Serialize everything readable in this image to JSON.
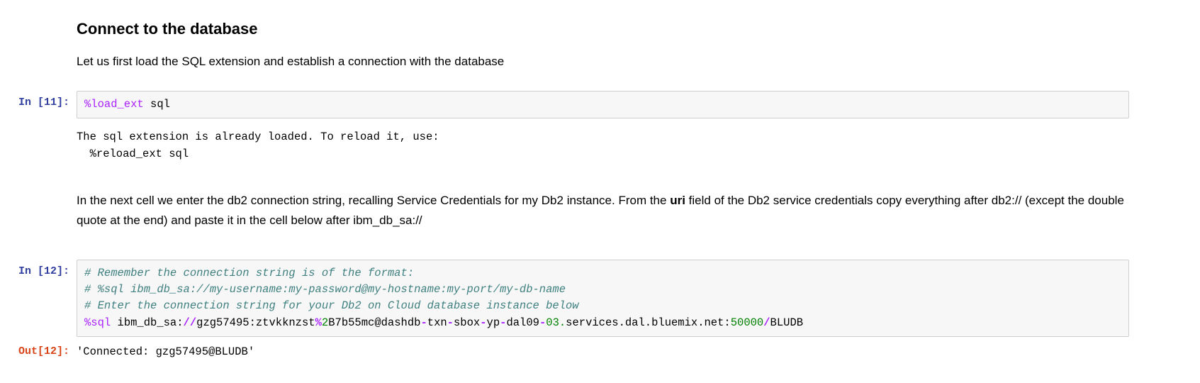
{
  "markdown": {
    "heading": "Connect to the database",
    "intro": "Let us first load the SQL extension and establish a connection with the database",
    "instruction_pre": "In the next cell we enter the db2 connection string, recalling Service Credentials for my Db2 instance. From the ",
    "instruction_bold": "uri",
    "instruction_post": " field of the Db2 service credentials copy everything after db2:// (except the double quote at the end) and paste it in the cell below after ibm_db_sa://"
  },
  "cell1": {
    "prompt": "In [11]:",
    "code": {
      "magic": "%load_ext",
      "arg": " sql"
    },
    "output": "The sql extension is already loaded. To reload it, use:\n  %reload_ext sql"
  },
  "cell2": {
    "prompt": "In [12]:",
    "code": {
      "c1": "# Remember the connection string is of the format:",
      "c2": "# %sql ibm_db_sa://my-username:my-password@my-hostname:my-port/my-db-name",
      "c3": "# Enter the connection string for your Db2 on Cloud database instance below",
      "magic": "%sql",
      "seg1": " ibm_db_sa:",
      "seg_op1": "//",
      "seg2": "gzg57495:ztvkknzst",
      "seg_op2": "%",
      "seg3a": "2",
      "seg3b": "B7b55mc@dashdb",
      "seg_dash1": "-",
      "seg4": "txn",
      "seg_dash2": "-",
      "seg5": "sbox",
      "seg_dash3": "-",
      "seg6": "yp",
      "seg_dash4": "-",
      "seg7": "dal09",
      "seg_dash5": "-",
      "seg8a": "03.",
      "seg8b": "services.dal.bluemix.net:",
      "seg9": "50000",
      "seg_slash": "/",
      "seg10": "BLUDB"
    },
    "out_prompt": "Out[12]:",
    "out_value": "'Connected: gzg57495@BLUDB'"
  }
}
